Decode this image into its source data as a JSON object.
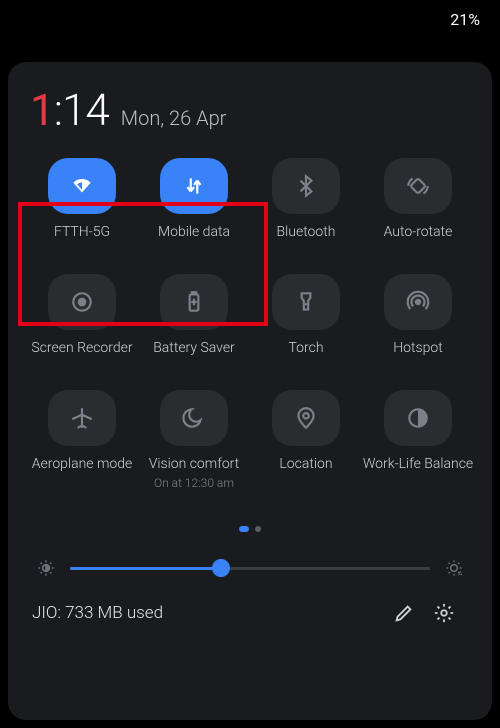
{
  "statusbar": {
    "battery": "21%"
  },
  "clock": {
    "hour": "1",
    "minute": "14"
  },
  "date": "Mon, 26 Apr",
  "tiles": [
    {
      "label": "FTTH-5G",
      "sub": ""
    },
    {
      "label": "Mobile data",
      "sub": ""
    },
    {
      "label": "Bluetooth",
      "sub": ""
    },
    {
      "label": "Auto-rotate",
      "sub": ""
    },
    {
      "label": "Screen Recorder",
      "sub": ""
    },
    {
      "label": "Battery Saver",
      "sub": ""
    },
    {
      "label": "Torch",
      "sub": ""
    },
    {
      "label": "Hotspot",
      "sub": ""
    },
    {
      "label": "Aeroplane mode",
      "sub": ""
    },
    {
      "label": "Vision comfort",
      "sub": "On at 12:30 am"
    },
    {
      "label": "Location",
      "sub": ""
    },
    {
      "label": "Work-Life Balance",
      "sub": ""
    }
  ],
  "brightness_pct": 42,
  "footer": {
    "usage": "JIO: 733 MB used"
  },
  "colors": {
    "accent": "#3a82f7",
    "highlight": "#e4021b"
  }
}
